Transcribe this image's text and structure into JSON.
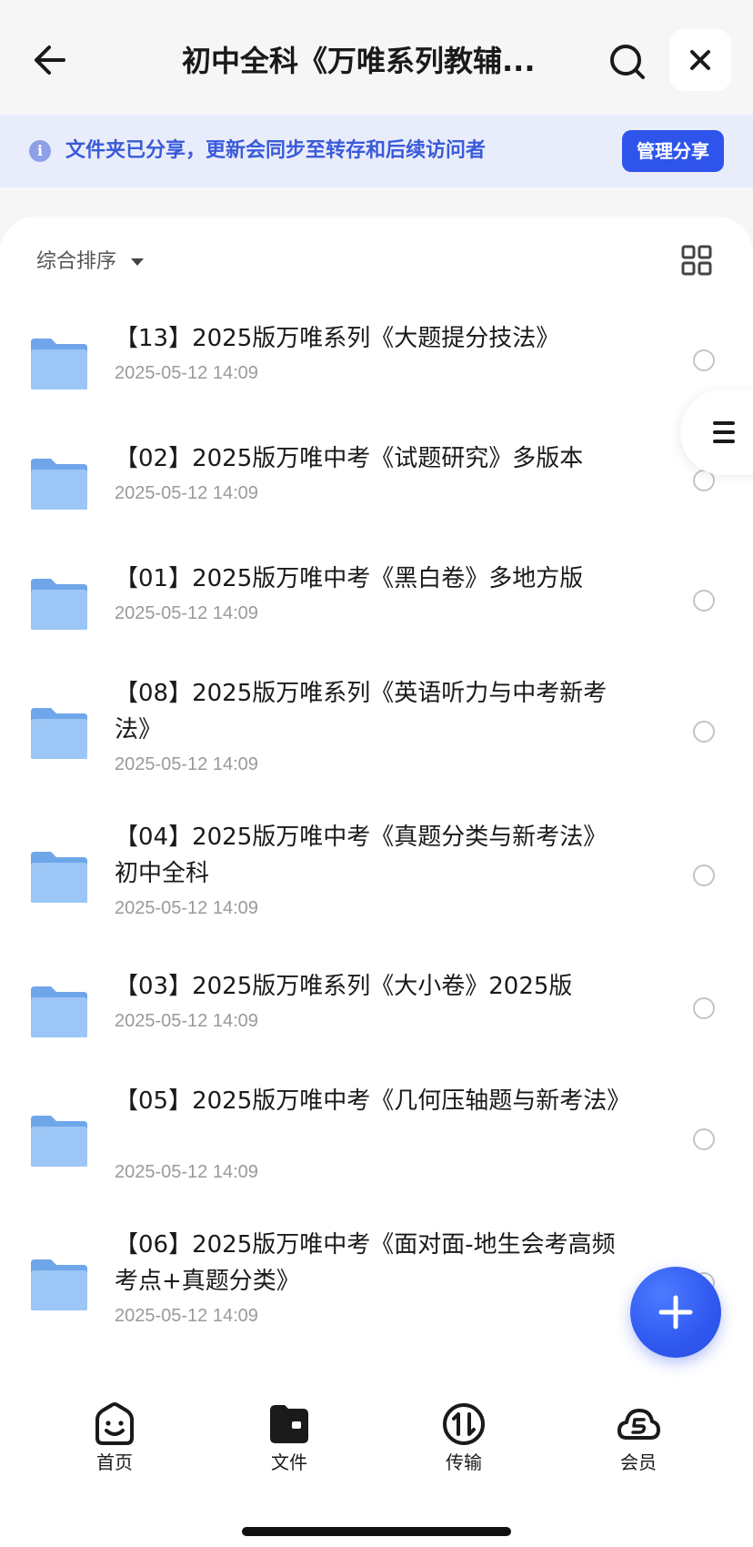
{
  "header": {
    "title": "初中全科《万唯系列教辅...",
    "back_icon": "arrow-left-icon",
    "search_icon": "search-icon",
    "close_icon": "close-icon"
  },
  "notice": {
    "icon": "info-icon",
    "icon_glyph": "i",
    "text": "文件夹已分享，更新会同步至转存和后续访问者",
    "manage_label": "管理分享"
  },
  "toolbar": {
    "sort_label": "综合排序",
    "grid_icon": "grid-view-icon"
  },
  "files": [
    {
      "title": "【13】2025版万唯系列《大题提分技法》",
      "date": "2025-05-12 14:09"
    },
    {
      "title": "【02】2025版万唯中考《试题研究》多版本",
      "date": "2025-05-12 14:09"
    },
    {
      "title": "【01】2025版万唯中考《黑白卷》多地方版",
      "date": "2025-05-12 14:09"
    },
    {
      "title": "【08】2025版万唯系列《英语听力与中考新考法》",
      "date": "2025-05-12 14:09"
    },
    {
      "title": "【04】2025版万唯中考《真题分类与新考法》初中全科",
      "date": "2025-05-12 14:09"
    },
    {
      "title": "【03】2025版万唯系列《大小卷》2025版",
      "date": "2025-05-12 14:09"
    },
    {
      "title": "【05】2025版万唯中考《几何压轴题与新考法》",
      "date": "2025-05-12 14:09"
    },
    {
      "title": "【06】2025版万唯中考《面对面-地生会考高频考点+真题分类》",
      "date": "2025-05-12 14:09"
    }
  ],
  "fab_icon": "plus-icon",
  "side_handle_icon": "menu-icon",
  "nav": [
    {
      "label": "首页",
      "icon": "home-smile-icon"
    },
    {
      "label": "文件",
      "icon": "folder-icon"
    },
    {
      "label": "传输",
      "icon": "transfer-icon"
    },
    {
      "label": "会员",
      "icon": "vip-cloud-icon"
    }
  ],
  "colors": {
    "accent": "#2f54eb",
    "notice_bg": "#e9edfb",
    "notice_text": "#3a5bd9",
    "folder": "#7fb3f0"
  }
}
